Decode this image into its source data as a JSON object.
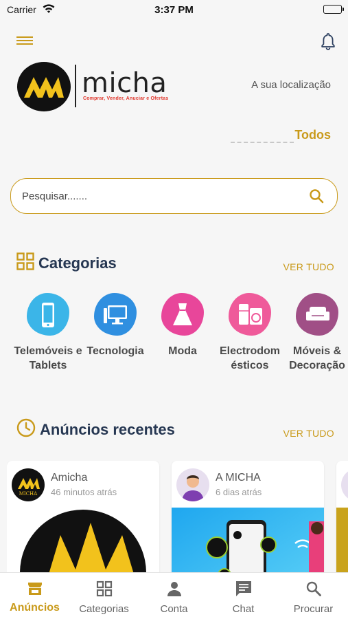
{
  "status_bar": {
    "carrier": "Carrier",
    "time": "3:37 PM"
  },
  "header": {
    "location_label": "A sua localização",
    "filter_label": "Todos",
    "logo": {
      "wordmark": "micha",
      "tagline": "Comprar, Vender, Anuciar e Ofertas"
    }
  },
  "search": {
    "placeholder": "Pesquisar......."
  },
  "categories": {
    "title": "Categorias",
    "see_all": "VER TUDO",
    "items": [
      {
        "label": "Telemóveis e Tablets",
        "icon": "smartphone-icon",
        "color": "#3bb5e8"
      },
      {
        "label": "Tecnologia",
        "icon": "desktop-computer-icon",
        "color": "#2f8fe0"
      },
      {
        "label": "Moda",
        "icon": "dress-icon",
        "color": "#e8469a"
      },
      {
        "label": "Electrodom ésticos",
        "icon": "appliances-icon",
        "color": "#ef5a9a"
      },
      {
        "label": "Móveis & Decoração",
        "icon": "sofa-icon",
        "color": "#a04f86"
      }
    ]
  },
  "recent": {
    "title": "Anúncios recentes",
    "see_all": "VER TUDO",
    "listings": [
      {
        "seller": "Amicha",
        "time": "46 minutos atrás",
        "avatar_text": "MICHA"
      },
      {
        "seller": "A MICHA",
        "time": "6 dias atrás"
      }
    ]
  },
  "bottom_nav": [
    {
      "label": "Anúncios",
      "icon": "storefront-icon",
      "active": true
    },
    {
      "label": "Categorias",
      "icon": "grid-icon",
      "active": false
    },
    {
      "label": "Conta",
      "icon": "person-icon",
      "active": false
    },
    {
      "label": "Chat",
      "icon": "chat-bubble-icon",
      "active": false
    },
    {
      "label": "Procurar",
      "icon": "search-icon",
      "active": false
    }
  ],
  "colors": {
    "accent": "#c99a1a",
    "heading": "#263752",
    "background": "#f6f6f6"
  }
}
